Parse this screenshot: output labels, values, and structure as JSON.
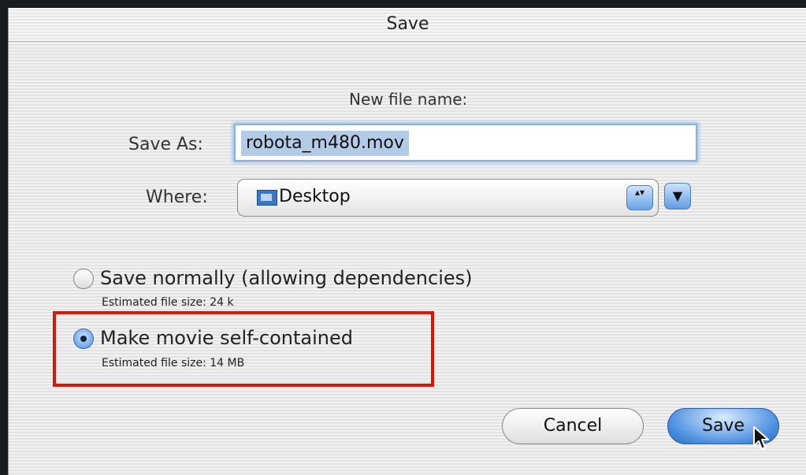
{
  "dialog": {
    "title": "Save",
    "new_file_label": "New file name:",
    "save_as_label": "Save As:",
    "filename_value": "robota_m480.mov",
    "where_label": "Where:",
    "where_value": "Desktop",
    "where_icon": "folder-icon",
    "updown_arrows": "▴▾",
    "expand_arrow": "▼"
  },
  "options": [
    {
      "label": "Save normally (allowing dependencies)",
      "size": "Estimated file size: 24 k",
      "selected": false
    },
    {
      "label": "Make movie self-contained",
      "size": "Estimated file size: 14 MB",
      "selected": true
    }
  ],
  "buttons": {
    "cancel": "Cancel",
    "save": "Save"
  },
  "colors": {
    "highlight": "#d21a0c",
    "aqua_blue": "#4b8fe0"
  }
}
